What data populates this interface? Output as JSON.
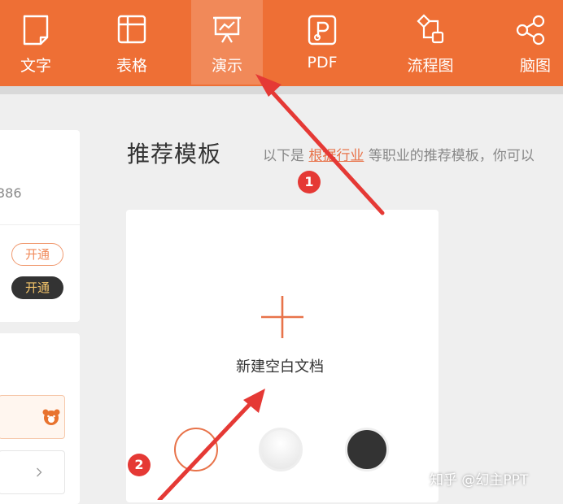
{
  "toolbar": {
    "tabs": [
      {
        "label": "文字",
        "icon": "document-icon"
      },
      {
        "label": "表格",
        "icon": "table-icon"
      },
      {
        "label": "演示",
        "icon": "presentation-icon",
        "active": true
      },
      {
        "label": "PDF",
        "icon": "pdf-icon"
      },
      {
        "label": "流程图",
        "icon": "flowchart-icon"
      },
      {
        "label": "脑图",
        "icon": "mindmap-icon"
      }
    ],
    "accent_color": "#ee6f35"
  },
  "left_panel": {
    "partial_number": "386",
    "activate_outline_label": "开通",
    "activate_dark_label": "开通",
    "chevron": "chevron-right-icon"
  },
  "main": {
    "section_title": "推荐模板",
    "desc_prefix": "以下是",
    "desc_highlight": "根据行业",
    "desc_suffix": "等职业的推荐模板，你可以",
    "new_blank_label": "新建空白文档",
    "swatches": [
      "white-outline-orange",
      "light-gray",
      "dark"
    ]
  },
  "annotations": {
    "badge_1": "1",
    "badge_2": "2"
  },
  "watermark": "知乎 @幻主PPT"
}
